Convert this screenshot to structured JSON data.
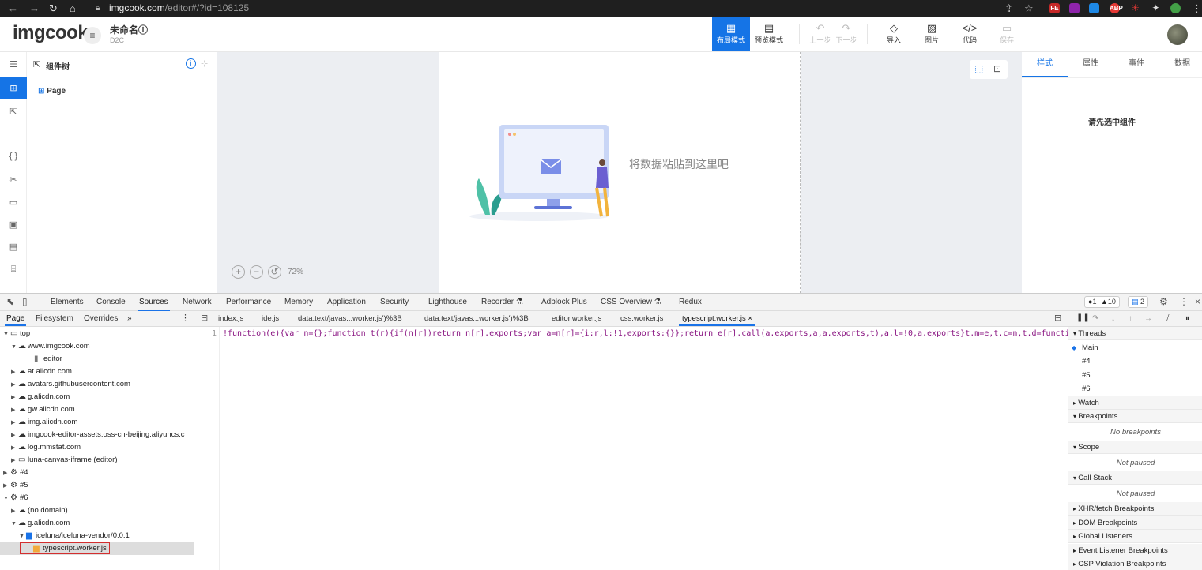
{
  "browser": {
    "url_host": "imgcook.com",
    "url_path": "/editor#/?id=108125"
  },
  "app": {
    "logo": "imgcook",
    "title": "未命名ⓘ",
    "subtitle": "D2C",
    "toolbar": [
      {
        "label": "布局模式",
        "state": "active",
        "icon": "layout-icon"
      },
      {
        "label": "预览模式",
        "state": "normal",
        "icon": "preview-icon"
      },
      {
        "label": "上一步",
        "state": "disabled",
        "icon": "undo-icon"
      },
      {
        "label": "下一步",
        "state": "disabled",
        "icon": "redo-icon"
      },
      {
        "label": "导入",
        "state": "normal",
        "icon": "diamond-icon"
      },
      {
        "label": "图片",
        "state": "normal",
        "icon": "image-icon"
      },
      {
        "label": "代码",
        "state": "normal",
        "icon": "code-icon"
      },
      {
        "label": "保存",
        "state": "disabled",
        "icon": "save-icon"
      }
    ]
  },
  "tree": {
    "title": "组件树",
    "root": "Page"
  },
  "canvas": {
    "paste_hint": "将数据粘贴到这里吧",
    "zoom": "72%"
  },
  "right_panel": {
    "tabs": [
      "样式",
      "属性",
      "事件",
      "数据"
    ],
    "active_tab": "样式",
    "empty_msg": "请先选中组件"
  },
  "devtools": {
    "tabs": [
      "Elements",
      "Console",
      "Sources",
      "Network",
      "Performance",
      "Memory",
      "Application",
      "Security",
      "Lighthouse",
      "Recorder ⚗",
      "Adblock Plus",
      "CSS Overview ⚗",
      "Redux"
    ],
    "active_tab": "Sources",
    "status": {
      "errors": "1",
      "warnings": "10",
      "messages": "2"
    },
    "sources_tabs": [
      "Page",
      "Filesystem",
      "Overrides",
      "»"
    ],
    "file_tabs": [
      "index.js",
      "ide.js",
      "data:text/javas...worker.js')%3B",
      "data:text/javas...worker.js')%3B",
      "editor.worker.js",
      "css.worker.js",
      "typescript.worker.js ×"
    ],
    "navigator": [
      {
        "label": "top",
        "indent": 0,
        "tri": "▼",
        "icon": "frame"
      },
      {
        "label": "www.imgcook.com",
        "indent": 1,
        "tri": "▼",
        "icon": "cloud"
      },
      {
        "label": "editor",
        "indent": 3,
        "tri": "",
        "icon": "file"
      },
      {
        "label": "at.alicdn.com",
        "indent": 1,
        "tri": "▶",
        "icon": "cloud"
      },
      {
        "label": "avatars.githubusercontent.com",
        "indent": 1,
        "tri": "▶",
        "icon": "cloud"
      },
      {
        "label": "g.alicdn.com",
        "indent": 1,
        "tri": "▶",
        "icon": "cloud"
      },
      {
        "label": "gw.alicdn.com",
        "indent": 1,
        "tri": "▶",
        "icon": "cloud"
      },
      {
        "label": "img.alicdn.com",
        "indent": 1,
        "tri": "▶",
        "icon": "cloud"
      },
      {
        "label": "imgcook-editor-assets.oss-cn-beijing.aliyuncs.c",
        "indent": 1,
        "tri": "▶",
        "icon": "cloud"
      },
      {
        "label": "log.mmstat.com",
        "indent": 1,
        "tri": "▶",
        "icon": "cloud"
      },
      {
        "label": "luna-canvas-iframe (editor)",
        "indent": 1,
        "tri": "▶",
        "icon": "frame"
      },
      {
        "label": "#4",
        "indent": 0,
        "tri": "▶",
        "icon": "gear"
      },
      {
        "label": "#5",
        "indent": 0,
        "tri": "▶",
        "icon": "gear"
      },
      {
        "label": "#6",
        "indent": 0,
        "tri": "▼",
        "icon": "gear"
      },
      {
        "label": "(no domain)",
        "indent": 1,
        "tri": "▶",
        "icon": "cloud"
      },
      {
        "label": "g.alicdn.com",
        "indent": 1,
        "tri": "▼",
        "icon": "cloud"
      },
      {
        "label": "iceluna/iceluna-vendor/0.0.1",
        "indent": 2,
        "tri": "▼",
        "icon": "folder"
      },
      {
        "label": "typescript.worker.js",
        "indent": 3,
        "tri": "",
        "icon": "jsfile",
        "selected": true
      }
    ],
    "code_line_no": "1",
    "code_line": "!function(e){var n={};function t(r){if(n[r])return n[r].exports;var a=n[r]={i:r,l:!1,exports:{}};return e[r].call(a.exports,a,a.exports,t),a.l=!0,a.exports}t.m=e,t.c=n,t.d=function(e,n,r",
    "debugger": [
      {
        "label": "Threads",
        "kind": "header",
        "open": true
      },
      {
        "label": "Main",
        "kind": "item",
        "current": true
      },
      {
        "label": "#4",
        "kind": "item"
      },
      {
        "label": "#5",
        "kind": "item"
      },
      {
        "label": "#6",
        "kind": "item"
      },
      {
        "label": "Watch",
        "kind": "header",
        "open": false
      },
      {
        "label": "Breakpoints",
        "kind": "header",
        "open": true
      },
      {
        "label": "No breakpoints",
        "kind": "empty"
      },
      {
        "label": "Scope",
        "kind": "header",
        "open": true
      },
      {
        "label": "Not paused",
        "kind": "empty"
      },
      {
        "label": "Call Stack",
        "kind": "header",
        "open": true
      },
      {
        "label": "Not paused",
        "kind": "empty"
      },
      {
        "label": "XHR/fetch Breakpoints",
        "kind": "header",
        "open": false
      },
      {
        "label": "DOM Breakpoints",
        "kind": "header",
        "open": false
      },
      {
        "label": "Global Listeners",
        "kind": "header",
        "open": false
      },
      {
        "label": "Event Listener Breakpoints",
        "kind": "header",
        "open": false
      },
      {
        "label": "CSP Violation Breakpoints",
        "kind": "header",
        "open": false
      }
    ]
  }
}
